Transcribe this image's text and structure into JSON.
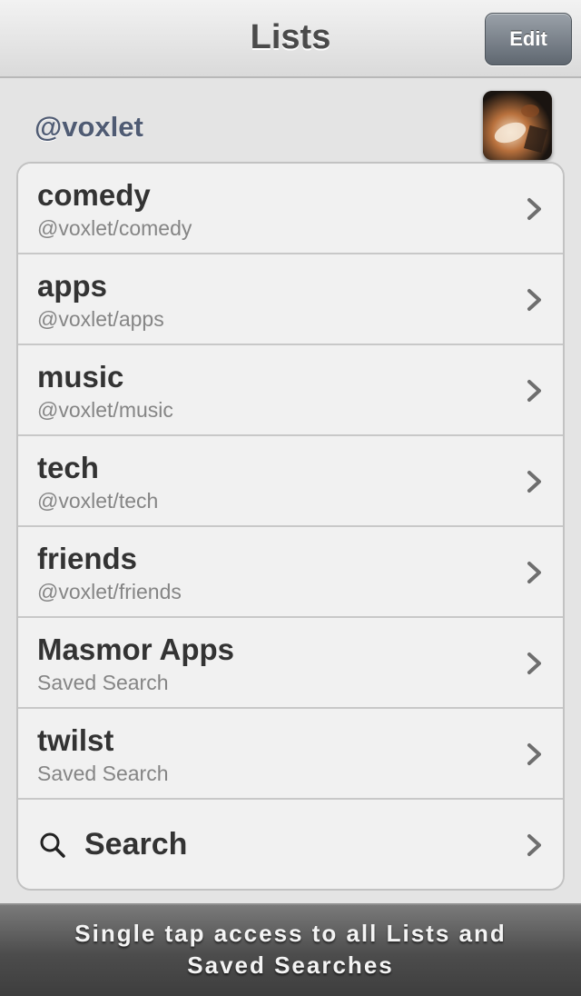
{
  "navbar": {
    "title": "Lists",
    "edit_label": "Edit"
  },
  "account": {
    "handle": "@voxlet",
    "avatar_icon": "profile-photo"
  },
  "lists": [
    {
      "title": "comedy",
      "subtitle": "@voxlet/comedy"
    },
    {
      "title": "apps",
      "subtitle": "@voxlet/apps"
    },
    {
      "title": "music",
      "subtitle": "@voxlet/music"
    },
    {
      "title": "tech",
      "subtitle": "@voxlet/tech"
    },
    {
      "title": "friends",
      "subtitle": "@voxlet/friends"
    },
    {
      "title": "Masmor Apps",
      "subtitle": "Saved Search"
    },
    {
      "title": "twilst",
      "subtitle": "Saved Search"
    }
  ],
  "search_row": {
    "label": "Search",
    "icon": "search-icon"
  },
  "promo": {
    "line1": "Single tap access to all Lists and",
    "line2": "Saved Searches"
  },
  "colors": {
    "handle": "#4f5b73",
    "edit_button": "#6b737b",
    "banner": "#4c4c4c"
  }
}
